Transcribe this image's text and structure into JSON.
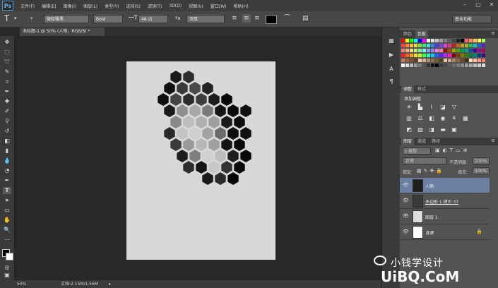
{
  "app": {
    "logo": "Ps"
  },
  "menu": [
    "文件(F)",
    "编辑(E)",
    "图像(I)",
    "图层(L)",
    "类型(Y)",
    "选择(S)",
    "滤镜(T)",
    "3D(D)",
    "视图(V)",
    "窗口(W)",
    "帮助(H)"
  ],
  "options": {
    "font_family": "微软雅黑",
    "font_style": "Bold",
    "font_size": "48 点",
    "antialias": "浑厚",
    "text_color": "#000000"
  },
  "workspace": "基本功能",
  "document": {
    "tab_label": "未标题-1 @ 50% (人物，RGB/8) *",
    "background": "#d8d8d8"
  },
  "status": {
    "zoom": "50%",
    "doc_size": "文档:2.15M/1.56M"
  },
  "swatches_panel": {
    "tabs": [
      "颜色",
      "色板"
    ],
    "active": 1
  },
  "adjustments_panel": {
    "tabs": [
      "调整",
      "样式"
    ],
    "title": "添加调整"
  },
  "layers_panel": {
    "tabs": [
      "图层",
      "通道",
      "路径"
    ],
    "filter_label": "类型",
    "blend_mode": "正常",
    "opacity_label": "不透明度:",
    "opacity_value": "100%",
    "lock_label": "锁定:",
    "fill_label": "填充:",
    "fill_value": "100%",
    "layers": [
      {
        "name": "人物",
        "selected": true
      },
      {
        "name": "多边形 1 拷贝 37",
        "selected": false
      },
      {
        "name": "图层 1",
        "selected": false
      },
      {
        "name": "背景",
        "selected": false
      }
    ]
  },
  "watermark": {
    "line1": "小钱学设计",
    "line2": "UiBQ.CoM"
  },
  "colors": {
    "selection_blue": "#6b7fa3",
    "menubar": "#3c3c3c",
    "panel": "#535353"
  }
}
